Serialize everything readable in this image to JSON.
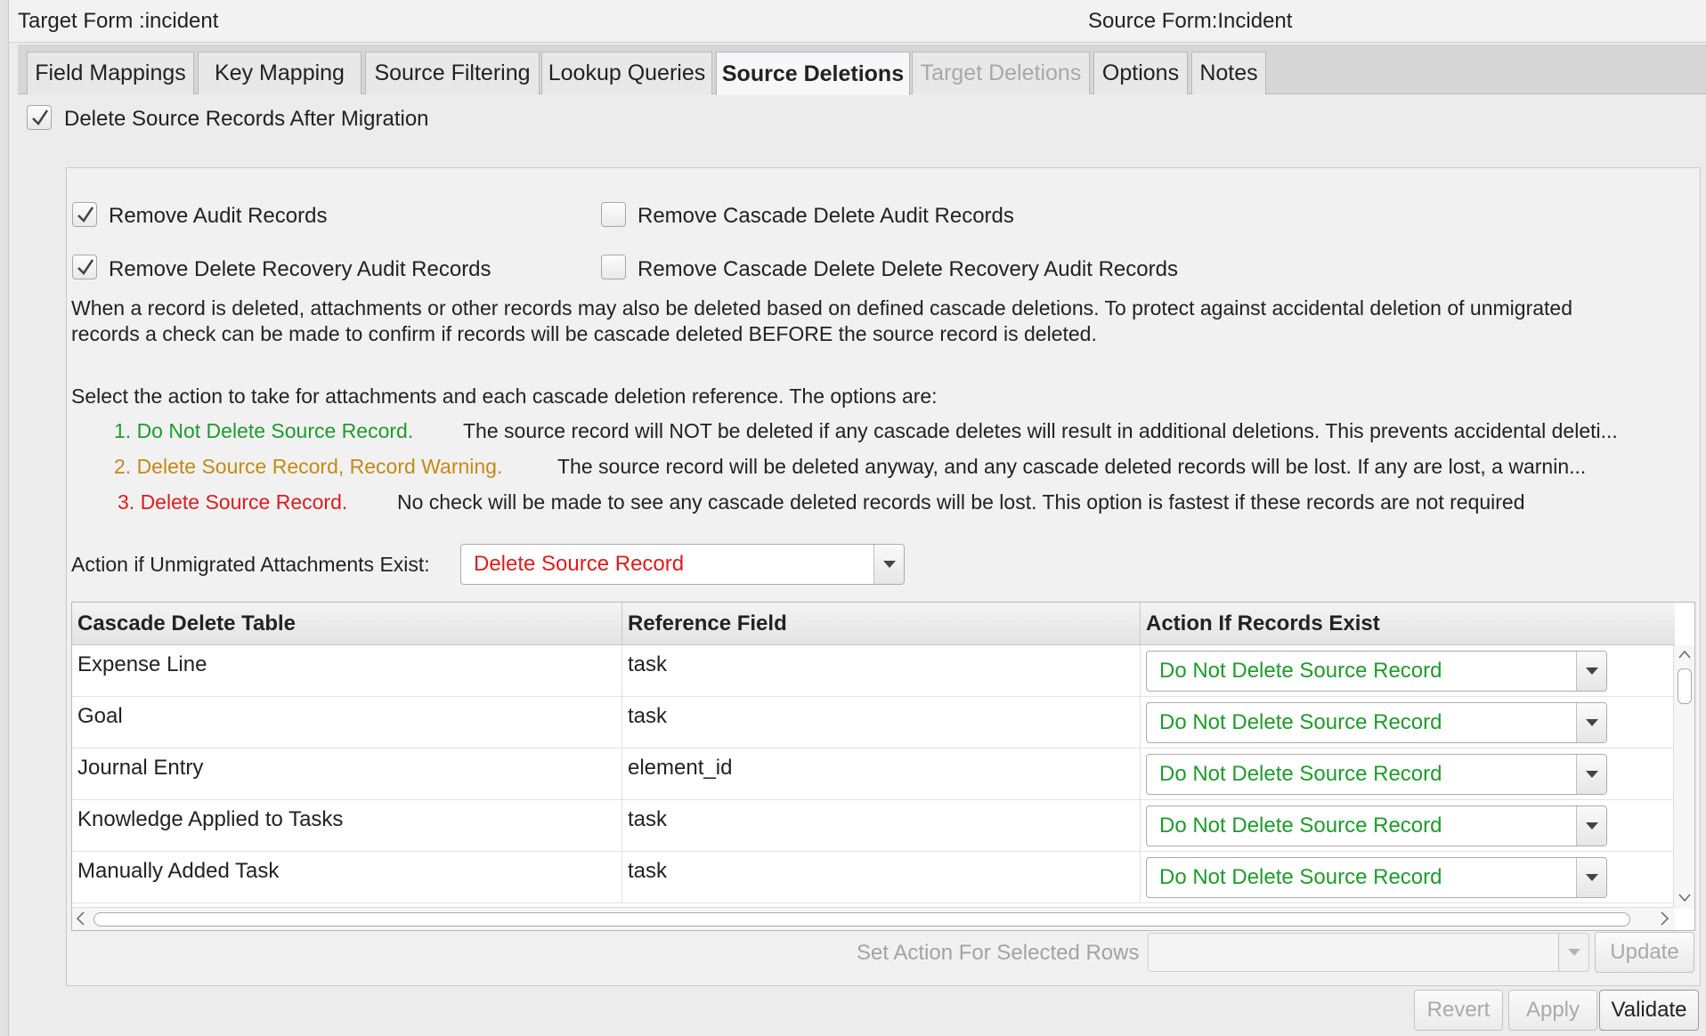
{
  "header": {
    "target_form": "Target Form :incident",
    "source_form": "Source Form:Incident"
  },
  "tabs": [
    {
      "label": "Field Mappings",
      "state": "normal"
    },
    {
      "label": "Key Mapping",
      "state": "normal"
    },
    {
      "label": "Source Filtering",
      "state": "normal"
    },
    {
      "label": "Lookup Queries",
      "state": "normal"
    },
    {
      "label": "Source Deletions",
      "state": "active"
    },
    {
      "label": "Target Deletions",
      "state": "disabled"
    },
    {
      "label": "Options",
      "state": "normal"
    },
    {
      "label": "Notes",
      "state": "normal"
    }
  ],
  "delete_after_migration": {
    "label": "Delete Source Records After Migration",
    "checked": true
  },
  "audit_options": {
    "remove_audit": {
      "label": "Remove Audit Records",
      "checked": true
    },
    "remove_delete_recovery": {
      "label": "Remove Delete Recovery Audit Records",
      "checked": true
    },
    "remove_cascade_audit": {
      "label": "Remove Cascade Delete Audit Records",
      "checked": false
    },
    "remove_cascade_delete_recovery": {
      "label": "Remove Cascade Delete Delete Recovery Audit Records",
      "checked": false
    }
  },
  "info": {
    "line1": "When a record is deleted, attachments or other records may also be deleted based on defined cascade deletions. To protect against accidental deletion of unmigrated",
    "line2": "records a check can be made to confirm if records will be cascade deleted BEFORE the source record is deleted.",
    "select_intro": "Select the action to take for attachments and each cascade deletion reference. The options are:"
  },
  "options": [
    {
      "title": "1. Do Not Delete Source Record.",
      "desc": "The source record will NOT be deleted if any cascade deletes will result in additional deletions. This prevents accidental deleti...",
      "color": "#1e9b2b"
    },
    {
      "title": "2. Delete Source Record, Record Warning.",
      "desc": "The source record will be deleted anyway, and any cascade deleted records will be lost. If any are lost, a warnin...",
      "color": "#c48a12"
    },
    {
      "title": "3. Delete Source Record.",
      "desc": "No check will be made to see any cascade deleted records will be lost. This option is fastest if these records are not required",
      "color": "#e01b1b"
    }
  ],
  "attachments": {
    "label": "Action if Unmigrated Attachments Exist:",
    "value": "Delete Source Record",
    "value_color": "#e01b1b"
  },
  "table": {
    "columns": [
      "Cascade Delete Table",
      "Reference Field",
      "Action If Records Exist"
    ],
    "rows": [
      {
        "table": "Expense Line",
        "field": "task",
        "action": "Do Not Delete Source Record"
      },
      {
        "table": "Goal",
        "field": "task",
        "action": "Do Not Delete Source Record"
      },
      {
        "table": "Journal Entry",
        "field": "element_id",
        "action": "Do Not Delete Source Record"
      },
      {
        "table": "Knowledge Applied to Tasks",
        "field": "task",
        "action": "Do Not Delete Source Record"
      },
      {
        "table": "Manually Added Task",
        "field": "task",
        "action": "Do Not Delete Source Record"
      }
    ],
    "action_color": "#1e9b2b"
  },
  "set_action": {
    "label": "Set Action For Selected Rows",
    "value": "",
    "update": "Update"
  },
  "footer": {
    "revert": "Revert",
    "apply": "Apply",
    "validate": "Validate"
  }
}
